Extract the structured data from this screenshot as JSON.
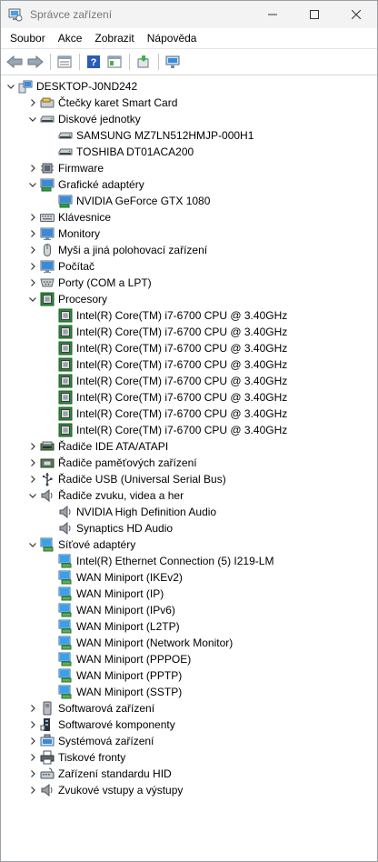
{
  "window": {
    "title": "Správce zařízení"
  },
  "menu": {
    "items": [
      "Soubor",
      "Akce",
      "Zobrazit",
      "Nápověda"
    ]
  },
  "toolbar": {
    "buttons": [
      "back-icon",
      "forward-icon",
      "properties-icon",
      "help-icon",
      "view-icon",
      "update-driver-icon",
      "scan-hardware-icon"
    ]
  },
  "tree": {
    "rows": [
      {
        "text": "DESKTOP-J0ND242",
        "level": 0,
        "expander": "open",
        "icon": "computer-icon"
      },
      {
        "text": "Čtečky karet Smart Card",
        "level": 1,
        "expander": "closed",
        "icon": "smartcard-reader-icon"
      },
      {
        "text": "Diskové jednotky",
        "level": 1,
        "expander": "open",
        "icon": "disk-drive-icon"
      },
      {
        "text": "SAMSUNG MZ7LN512HMJP-000H1",
        "level": 2,
        "expander": "none",
        "icon": "disk-drive-icon"
      },
      {
        "text": "TOSHIBA DT01ACA200",
        "level": 2,
        "expander": "none",
        "icon": "disk-drive-icon"
      },
      {
        "text": "Firmware",
        "level": 1,
        "expander": "closed",
        "icon": "firmware-icon"
      },
      {
        "text": "Grafické adaptéry",
        "level": 1,
        "expander": "open",
        "icon": "display-adapter-icon"
      },
      {
        "text": "NVIDIA GeForce GTX 1080",
        "level": 2,
        "expander": "none",
        "icon": "display-adapter-icon"
      },
      {
        "text": "Klávesnice",
        "level": 1,
        "expander": "closed",
        "icon": "keyboard-icon"
      },
      {
        "text": "Monitory",
        "level": 1,
        "expander": "closed",
        "icon": "monitor-icon"
      },
      {
        "text": "Myši a jiná polohovací zařízení",
        "level": 1,
        "expander": "closed",
        "icon": "mouse-icon"
      },
      {
        "text": "Počítač",
        "level": 1,
        "expander": "closed",
        "icon": "monitor-icon"
      },
      {
        "text": "Porty (COM a LPT)",
        "level": 1,
        "expander": "closed",
        "icon": "port-icon"
      },
      {
        "text": "Procesory",
        "level": 1,
        "expander": "open",
        "icon": "processor-icon"
      },
      {
        "text": "Intel(R) Core(TM) i7-6700 CPU @ 3.40GHz",
        "level": 2,
        "expander": "none",
        "icon": "processor-icon"
      },
      {
        "text": "Intel(R) Core(TM) i7-6700 CPU @ 3.40GHz",
        "level": 2,
        "expander": "none",
        "icon": "processor-icon"
      },
      {
        "text": "Intel(R) Core(TM) i7-6700 CPU @ 3.40GHz",
        "level": 2,
        "expander": "none",
        "icon": "processor-icon"
      },
      {
        "text": "Intel(R) Core(TM) i7-6700 CPU @ 3.40GHz",
        "level": 2,
        "expander": "none",
        "icon": "processor-icon"
      },
      {
        "text": "Intel(R) Core(TM) i7-6700 CPU @ 3.40GHz",
        "level": 2,
        "expander": "none",
        "icon": "processor-icon"
      },
      {
        "text": "Intel(R) Core(TM) i7-6700 CPU @ 3.40GHz",
        "level": 2,
        "expander": "none",
        "icon": "processor-icon"
      },
      {
        "text": "Intel(R) Core(TM) i7-6700 CPU @ 3.40GHz",
        "level": 2,
        "expander": "none",
        "icon": "processor-icon"
      },
      {
        "text": "Intel(R) Core(TM) i7-6700 CPU @ 3.40GHz",
        "level": 2,
        "expander": "none",
        "icon": "processor-icon"
      },
      {
        "text": "Řadiče IDE ATA/ATAPI",
        "level": 1,
        "expander": "closed",
        "icon": "ide-controller-icon"
      },
      {
        "text": "Řadiče paměťových zařízení",
        "level": 1,
        "expander": "closed",
        "icon": "storage-controller-icon"
      },
      {
        "text": "Řadiče USB (Universal Serial Bus)",
        "level": 1,
        "expander": "closed",
        "icon": "usb-icon"
      },
      {
        "text": "Řadiče zvuku, videa a her",
        "level": 1,
        "expander": "open",
        "icon": "speaker-icon"
      },
      {
        "text": "NVIDIA High Definition Audio",
        "level": 2,
        "expander": "none",
        "icon": "speaker-icon"
      },
      {
        "text": "Synaptics HD Audio",
        "level": 2,
        "expander": "none",
        "icon": "speaker-icon"
      },
      {
        "text": "Síťové adaptéry",
        "level": 1,
        "expander": "open",
        "icon": "network-adapter-icon"
      },
      {
        "text": "Intel(R) Ethernet Connection (5) I219-LM",
        "level": 2,
        "expander": "none",
        "icon": "network-adapter-icon"
      },
      {
        "text": "WAN Miniport (IKEv2)",
        "level": 2,
        "expander": "none",
        "icon": "network-adapter-icon"
      },
      {
        "text": "WAN Miniport (IP)",
        "level": 2,
        "expander": "none",
        "icon": "network-adapter-icon"
      },
      {
        "text": "WAN Miniport (IPv6)",
        "level": 2,
        "expander": "none",
        "icon": "network-adapter-icon"
      },
      {
        "text": "WAN Miniport (L2TP)",
        "level": 2,
        "expander": "none",
        "icon": "network-adapter-icon"
      },
      {
        "text": "WAN Miniport (Network Monitor)",
        "level": 2,
        "expander": "none",
        "icon": "network-adapter-icon"
      },
      {
        "text": "WAN Miniport (PPPOE)",
        "level": 2,
        "expander": "none",
        "icon": "network-adapter-icon"
      },
      {
        "text": "WAN Miniport (PPTP)",
        "level": 2,
        "expander": "none",
        "icon": "network-adapter-icon"
      },
      {
        "text": "WAN Miniport (SSTP)",
        "level": 2,
        "expander": "none",
        "icon": "network-adapter-icon"
      },
      {
        "text": "Softwarová zařízení",
        "level": 1,
        "expander": "closed",
        "icon": "software-device-icon"
      },
      {
        "text": "Softwarové komponenty",
        "level": 1,
        "expander": "closed",
        "icon": "software-component-icon"
      },
      {
        "text": "Systémová zařízení",
        "level": 1,
        "expander": "closed",
        "icon": "system-device-icon"
      },
      {
        "text": "Tiskové fronty",
        "level": 1,
        "expander": "closed",
        "icon": "printer-icon"
      },
      {
        "text": "Zařízení standardu HID",
        "level": 1,
        "expander": "closed",
        "icon": "hid-icon"
      },
      {
        "text": "Zvukové vstupy a výstupy",
        "level": 1,
        "expander": "closed",
        "icon": "speaker-icon"
      }
    ]
  }
}
